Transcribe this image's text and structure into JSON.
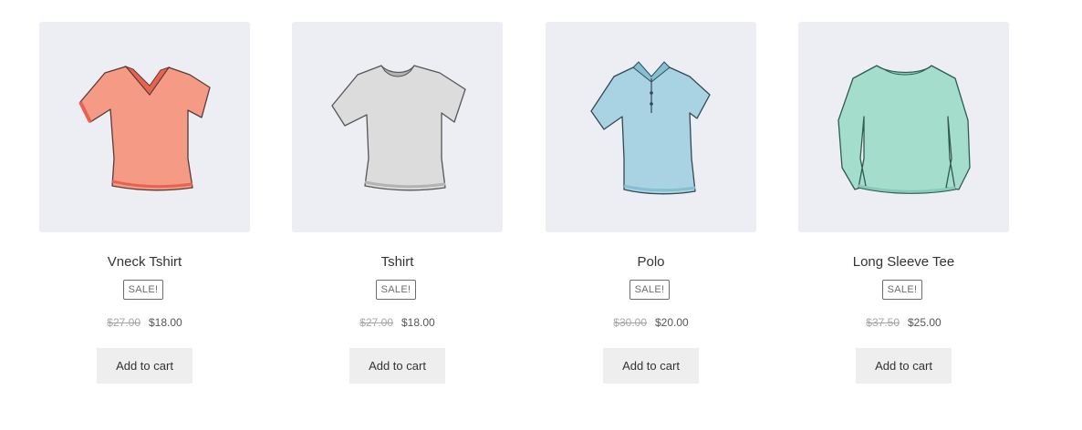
{
  "products": [
    {
      "title": "Vneck Tshirt",
      "badge": "SALE!",
      "old_price": "$27.00",
      "new_price": "$18.00",
      "button_label": "Add to cart",
      "image": "vneck-tshirt-illustration",
      "color": "#f59a85"
    },
    {
      "title": "Tshirt",
      "badge": "SALE!",
      "old_price": "$27.00",
      "new_price": "$18.00",
      "button_label": "Add to cart",
      "image": "tshirt-illustration",
      "color": "#dcdcdc"
    },
    {
      "title": "Polo",
      "badge": "SALE!",
      "old_price": "$30.00",
      "new_price": "$20.00",
      "button_label": "Add to cart",
      "image": "polo-shirt-illustration",
      "color": "#a9d3e2"
    },
    {
      "title": "Long Sleeve Tee",
      "badge": "SALE!",
      "old_price": "$37.50",
      "new_price": "$25.00",
      "button_label": "Add to cart",
      "image": "long-sleeve-tee-illustration",
      "color": "#a5ddcd"
    }
  ]
}
